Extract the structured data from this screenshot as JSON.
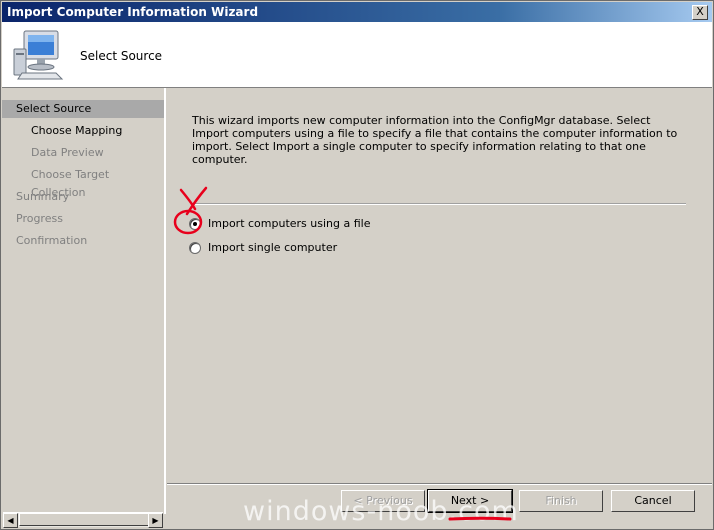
{
  "window": {
    "title": "Import Computer Information Wizard",
    "close_label": "X"
  },
  "header": {
    "title": "Select Source",
    "icon": "computer-monitor-icon"
  },
  "sidebar": {
    "items": [
      {
        "label": "Select Source"
      },
      {
        "label": "Choose Mapping"
      },
      {
        "label": "Data Preview"
      },
      {
        "label": "Choose Target Collection"
      },
      {
        "label": "Summary"
      },
      {
        "label": "Progress"
      },
      {
        "label": "Confirmation"
      }
    ]
  },
  "content": {
    "description": "This wizard imports new computer information into the ConfigMgr database. Select Import computers using a file to specify a file that contains the computer information to import. Select Import a single computer to specify information relating to that one computer.",
    "options": [
      {
        "label": "Import computers using a file",
        "selected": true
      },
      {
        "label": "Import single computer",
        "selected": false
      }
    ]
  },
  "buttons": {
    "previous": "< Previous",
    "next": "Next >",
    "finish": "Finish",
    "cancel": "Cancel"
  },
  "watermark": "windows-noob.com",
  "colors": {
    "annotation": "#e8001c",
    "titlebar": "#0a246a",
    "active_step": "#a9a9a9"
  }
}
